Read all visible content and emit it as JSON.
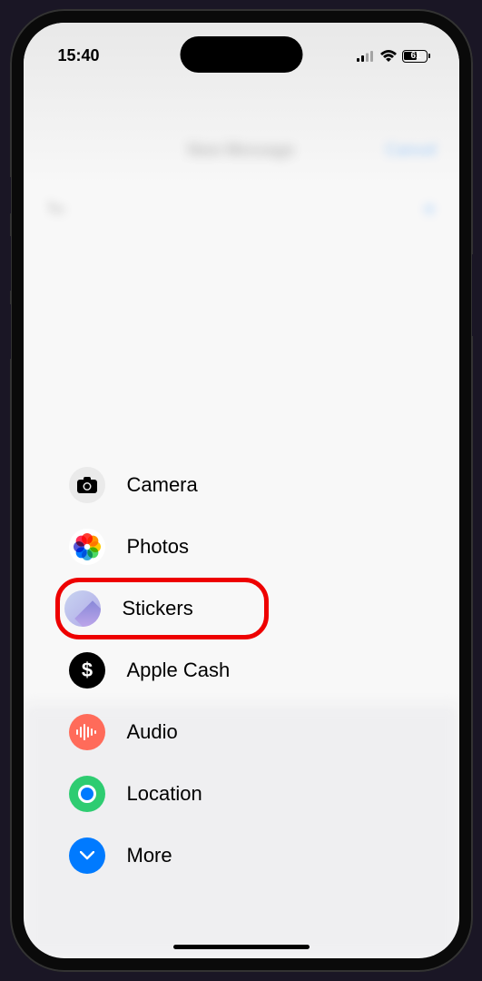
{
  "status": {
    "time": "15:40",
    "battery_level": "61"
  },
  "blurred": {
    "title": "New Message",
    "action": "Cancel",
    "to_label": "To:"
  },
  "menu": {
    "items": [
      {
        "label": "Camera",
        "icon": "camera-icon"
      },
      {
        "label": "Photos",
        "icon": "photos-icon"
      },
      {
        "label": "Stickers",
        "icon": "stickers-icon"
      },
      {
        "label": "Apple Cash",
        "icon": "apple-cash-icon"
      },
      {
        "label": "Audio",
        "icon": "audio-icon"
      },
      {
        "label": "Location",
        "icon": "location-icon"
      },
      {
        "label": "More",
        "icon": "more-icon"
      }
    ],
    "highlighted_index": 2
  }
}
